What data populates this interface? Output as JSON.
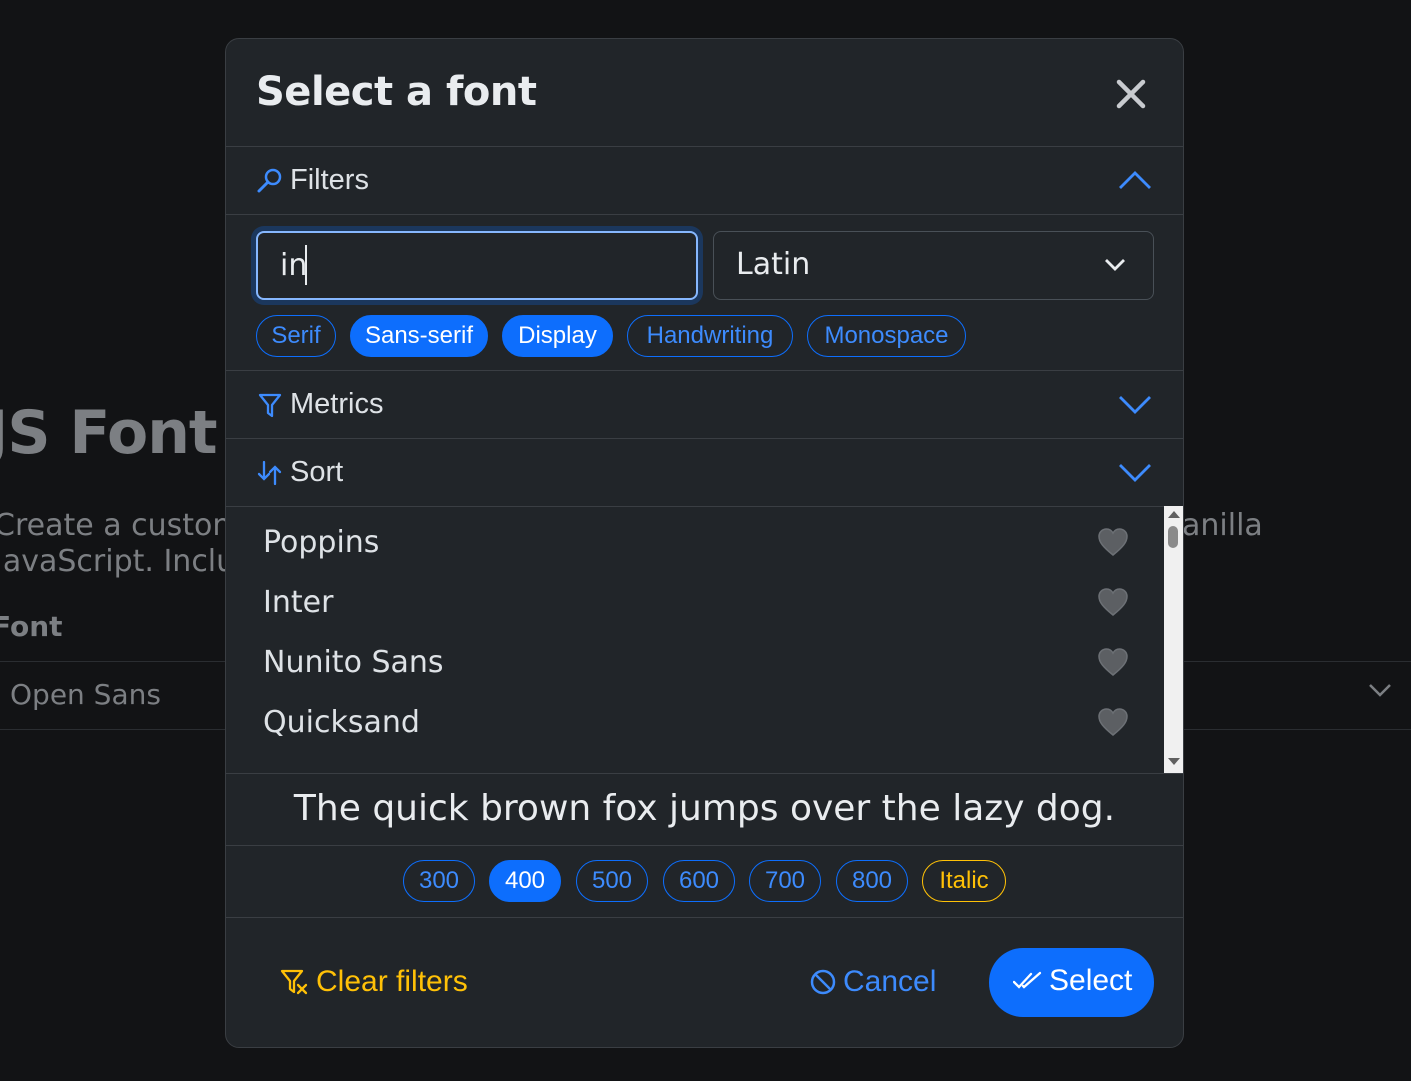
{
  "background": {
    "title": "JS Font P",
    "description_left_line1": "Create a customi",
    "description_left_line2": "JavaScript. Inclu",
    "description_right": "anilla",
    "font_label": "Font",
    "font_value": "Open Sans"
  },
  "modal": {
    "title": "Select a font",
    "filters_label": "Filters",
    "search_value": "in",
    "script_value": "Latin",
    "categories": [
      {
        "label": "Serif",
        "active": false
      },
      {
        "label": "Sans-serif",
        "active": true
      },
      {
        "label": "Display",
        "active": true
      },
      {
        "label": "Handwriting",
        "active": false
      },
      {
        "label": "Monospace",
        "active": false
      }
    ],
    "metrics_label": "Metrics",
    "sort_label": "Sort",
    "fonts": [
      "Poppins",
      "Inter",
      "Nunito Sans",
      "Quicksand"
    ],
    "preview_text": "The quick brown fox jumps over the lazy dog.",
    "weights": [
      {
        "label": "300",
        "active": false
      },
      {
        "label": "400",
        "active": true
      },
      {
        "label": "500",
        "active": false
      },
      {
        "label": "600",
        "active": false
      },
      {
        "label": "700",
        "active": false
      },
      {
        "label": "800",
        "active": false
      }
    ],
    "italic_label": "Italic",
    "clear_filters_label": "Clear filters",
    "cancel_label": "Cancel",
    "select_label": "Select"
  },
  "colors": {
    "primary": "#0d6efd",
    "warning": "#ffc107",
    "modal_bg": "#212529",
    "page_bg": "#121315"
  }
}
